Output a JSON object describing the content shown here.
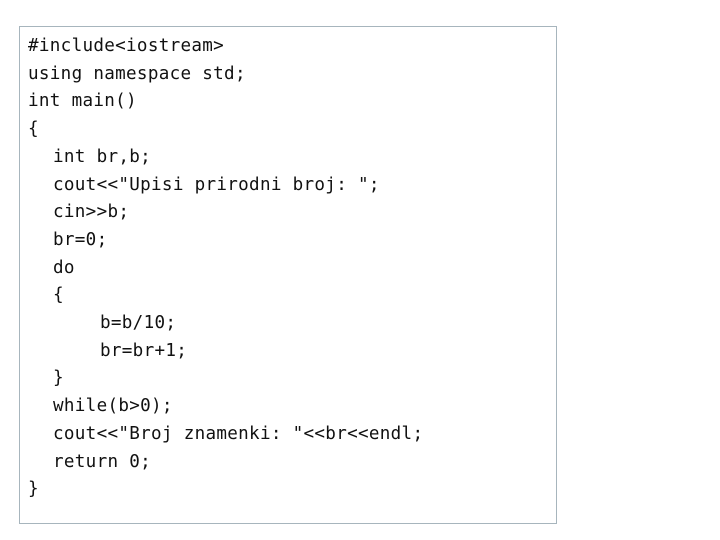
{
  "code": {
    "language": "C++",
    "lines": [
      {
        "indent": 0,
        "text": "#include<iostream>"
      },
      {
        "indent": 0,
        "text": "using namespace std;"
      },
      {
        "indent": 0,
        "text": "int main()"
      },
      {
        "indent": 0,
        "text": "{"
      },
      {
        "indent": 1,
        "text": "int br,b;"
      },
      {
        "indent": 1,
        "text": "cout<<\"Upisi prirodni broj: \";"
      },
      {
        "indent": 1,
        "text": "cin>>b;"
      },
      {
        "indent": 1,
        "text": "br=0;"
      },
      {
        "indent": 1,
        "text": "do"
      },
      {
        "indent": 1,
        "text": "{"
      },
      {
        "indent": 2,
        "text": "b=b/10;"
      },
      {
        "indent": 2,
        "text": "br=br+1;"
      },
      {
        "indent": 1,
        "text": "}"
      },
      {
        "indent": 1,
        "text": "while(b>0);"
      },
      {
        "indent": 1,
        "text": "cout<<\"Broj znamenki: \"<<br<<endl;"
      },
      {
        "indent": 1,
        "text": "return 0;"
      },
      {
        "indent": 0,
        "text": "}"
      }
    ]
  }
}
